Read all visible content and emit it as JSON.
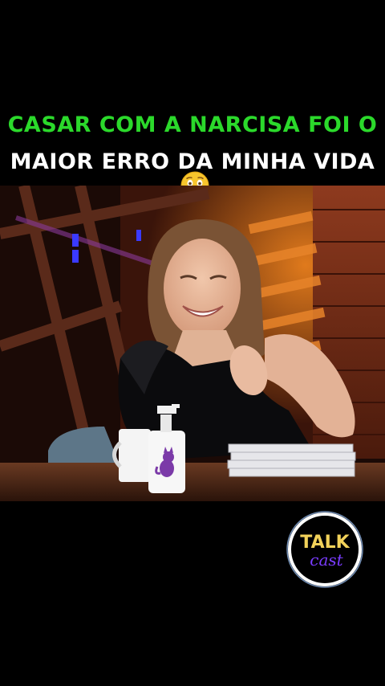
{
  "caption": {
    "line1": "CASAR COM A NARCISA FOI O",
    "line2": "MAIOR ERRO DA MINHA VIDA",
    "emoji": "astonished-face-icon",
    "line1_color": "#2bd92b",
    "line2_color": "#ffffff"
  },
  "video": {
    "scene": "talk-show-set"
  },
  "logo": {
    "top_text": "TALK",
    "bottom_text": "cast",
    "ring_color": "#ffffff",
    "text_top_color": "#f2d25a",
    "text_bottom_color": "#7a3cff"
  }
}
